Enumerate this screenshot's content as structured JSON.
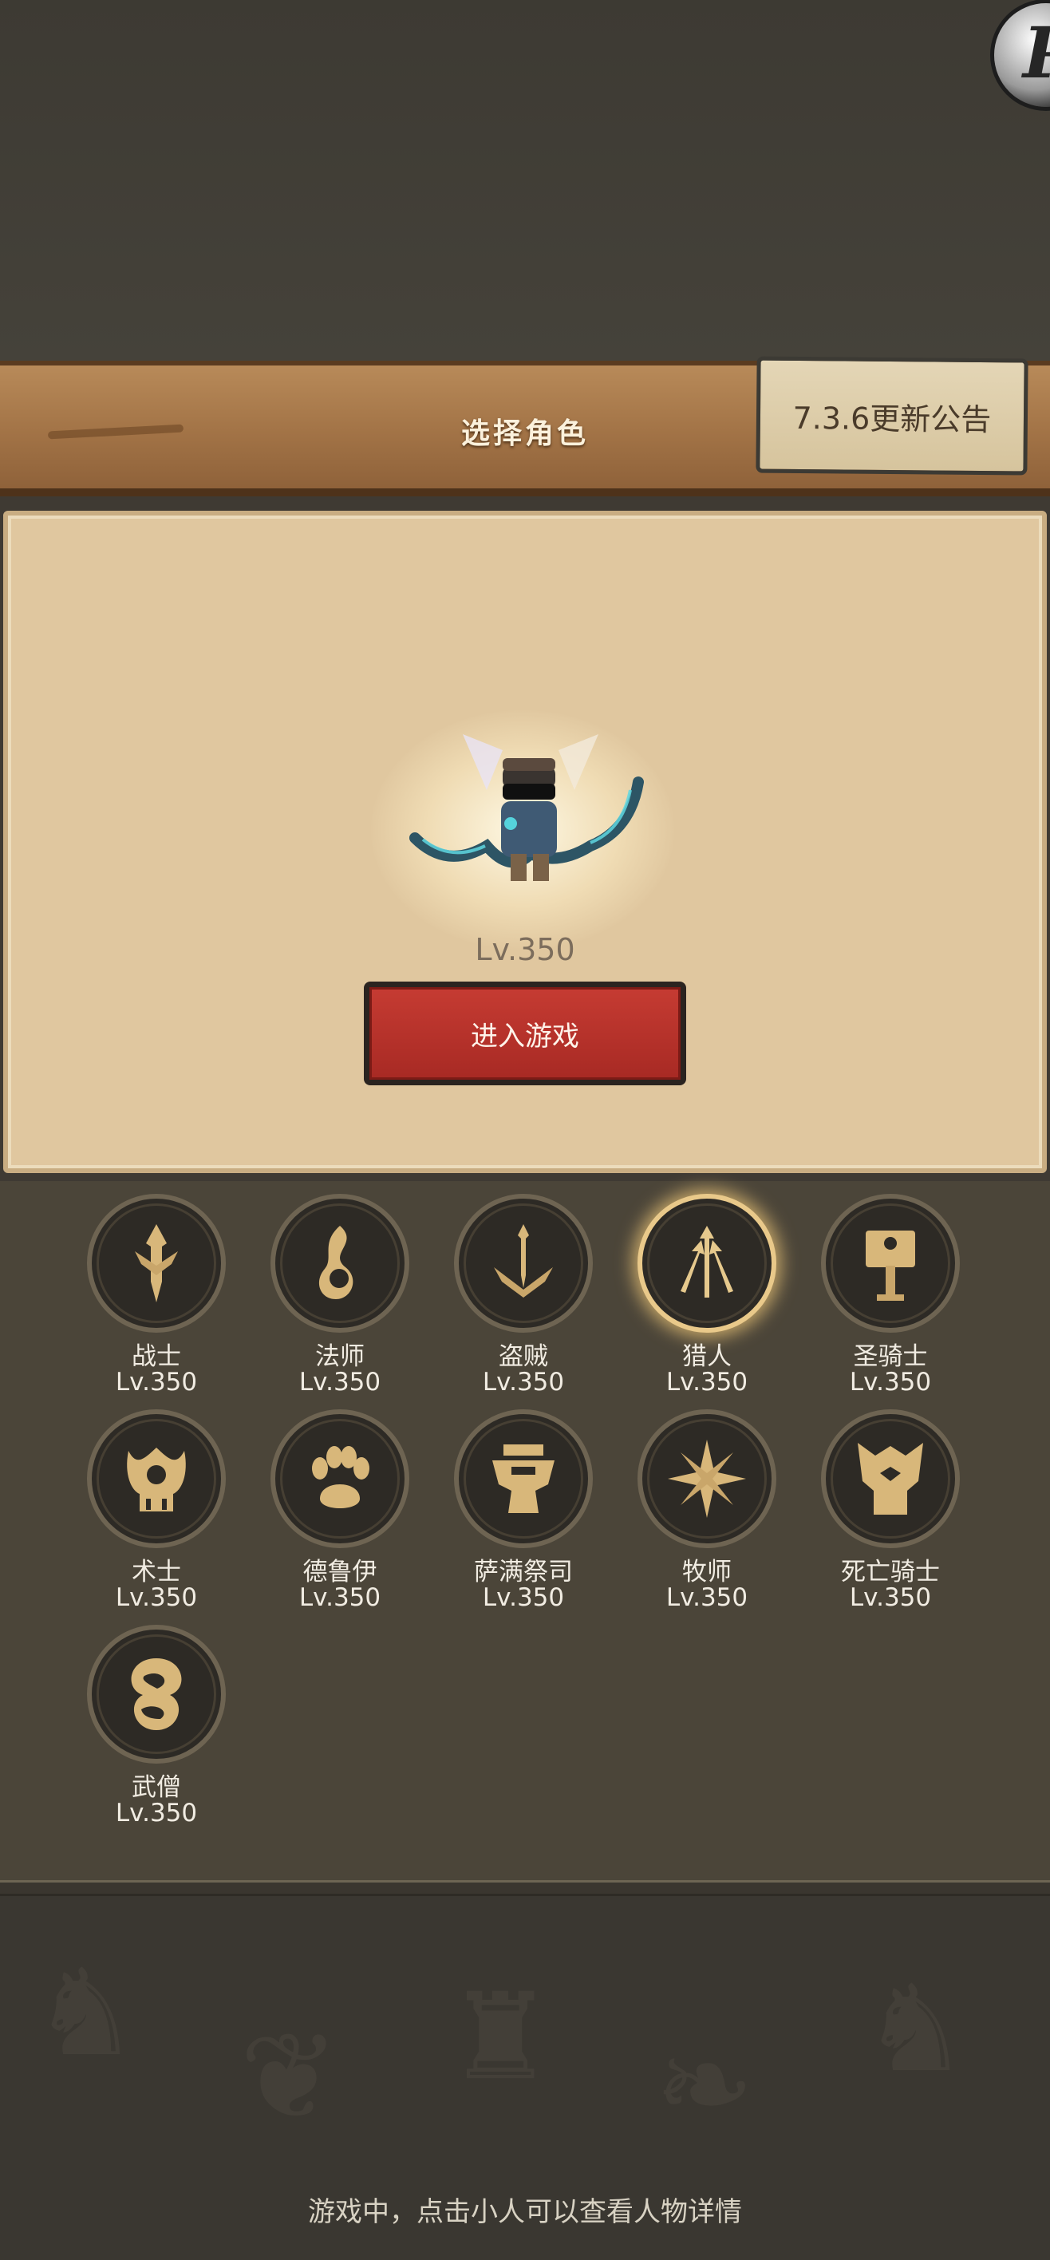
{
  "header": {
    "title": "选择角色",
    "notice_label": "7.3.6更新公告"
  },
  "avatar": {
    "letter": "P"
  },
  "selected_character": {
    "level": "Lv.350",
    "enter_button": "进入游戏"
  },
  "classes": [
    {
      "name": "战士",
      "level": "Lv.350",
      "icon": "warrior-sword-icon"
    },
    {
      "name": "法师",
      "level": "Lv.350",
      "icon": "mage-flame-icon"
    },
    {
      "name": "盗贼",
      "level": "Lv.350",
      "icon": "rogue-daggers-icon"
    },
    {
      "name": "猎人",
      "level": "Lv.350",
      "icon": "hunter-arrows-icon",
      "selected": true
    },
    {
      "name": "圣骑士",
      "level": "Lv.350",
      "icon": "paladin-hammer-icon"
    },
    {
      "name": "术士",
      "level": "Lv.350",
      "icon": "warlock-skull-icon"
    },
    {
      "name": "德鲁伊",
      "level": "Lv.350",
      "icon": "druid-paw-icon"
    },
    {
      "name": "萨满祭司",
      "level": "Lv.350",
      "icon": "shaman-totem-icon"
    },
    {
      "name": "牧师",
      "level": "Lv.350",
      "icon": "priest-star-icon"
    },
    {
      "name": "死亡骑士",
      "level": "Lv.350",
      "icon": "deathknight-helm-icon"
    },
    {
      "name": "武僧",
      "level": "Lv.350",
      "icon": "monk-swirl-icon"
    }
  ],
  "footer": {
    "hint": "游戏中，点击小人可以查看人物详情"
  },
  "colors": {
    "accent_red": "#b8302a",
    "gold": "#d8b77a",
    "panel": "#e0c79f",
    "wood": "#a27346"
  }
}
